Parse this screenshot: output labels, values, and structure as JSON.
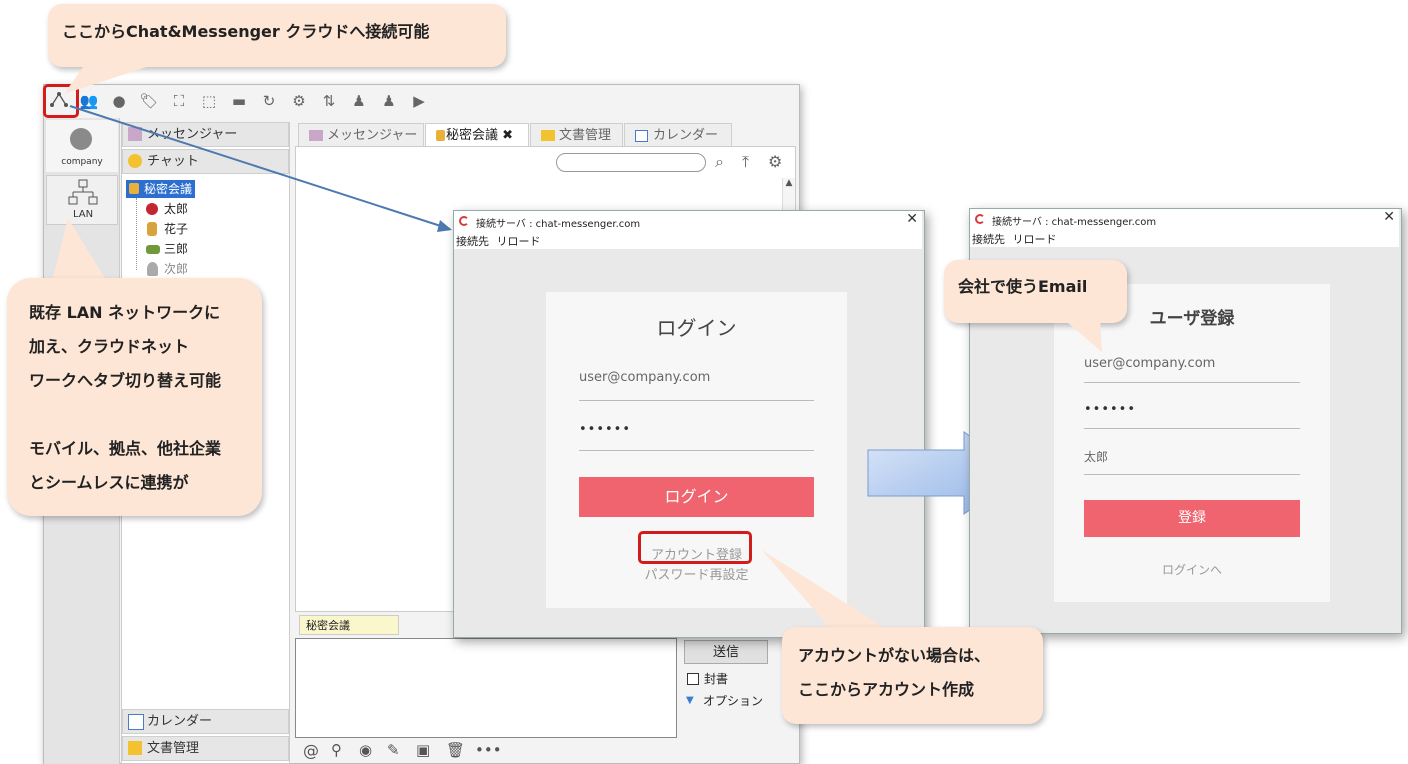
{
  "callouts": {
    "top": "ここからChat&Messenger クラウドへ接続可能",
    "left_lines": [
      "既存 LAN ネットワークに",
      "加え、クラウドネット",
      "ワークへタブ切り替え可能",
      "",
      "モバイル、拠点、他社企業",
      "とシームレスに連携が"
    ],
    "email": "会社で使うEmail",
    "account_lines": [
      "アカウントがない場合は、",
      "ここからアカウント作成"
    ]
  },
  "sidebar": {
    "company_label": "company",
    "lan_label": "LAN"
  },
  "accordion": {
    "messenger": "メッセンジャー",
    "chat": "チャット",
    "calendar": "カレンダー",
    "docs": "文書管理"
  },
  "tree": {
    "root": "秘密会議",
    "members": [
      "太郎",
      "花子",
      "三郎",
      "次郎"
    ]
  },
  "tabs": [
    "メッセンジャー",
    "秘密会議",
    "文書管理",
    "カレンダー"
  ],
  "chat": {
    "room_label": "秘密会議",
    "send_label": "送信",
    "seal_label": "封書",
    "option_label": "オプション"
  },
  "login_dialog": {
    "title": "接続サーバ : chat-messenger.com",
    "menu": [
      "接続先",
      "リロード"
    ],
    "heading": "ログイン",
    "email_value": "user@company.com",
    "password_value": "••••••",
    "login_button": "ログイン",
    "register_link": "アカウント登録",
    "reset_link": "パスワード再設定"
  },
  "register_dialog": {
    "title": "接続サーバ : chat-messenger.com",
    "menu": [
      "接続先",
      "リロード"
    ],
    "heading": "ユーザ登録",
    "email_value": "user@company.com",
    "password_value": "••••••",
    "name_value": "太郎",
    "register_button": "登録",
    "login_link": "ログインへ"
  },
  "colors": {
    "accent_red": "#f0646f",
    "callout_bg": "#fde6d6",
    "highlight": "#d21c1c",
    "arrow_blue": "#a9c3ea"
  }
}
